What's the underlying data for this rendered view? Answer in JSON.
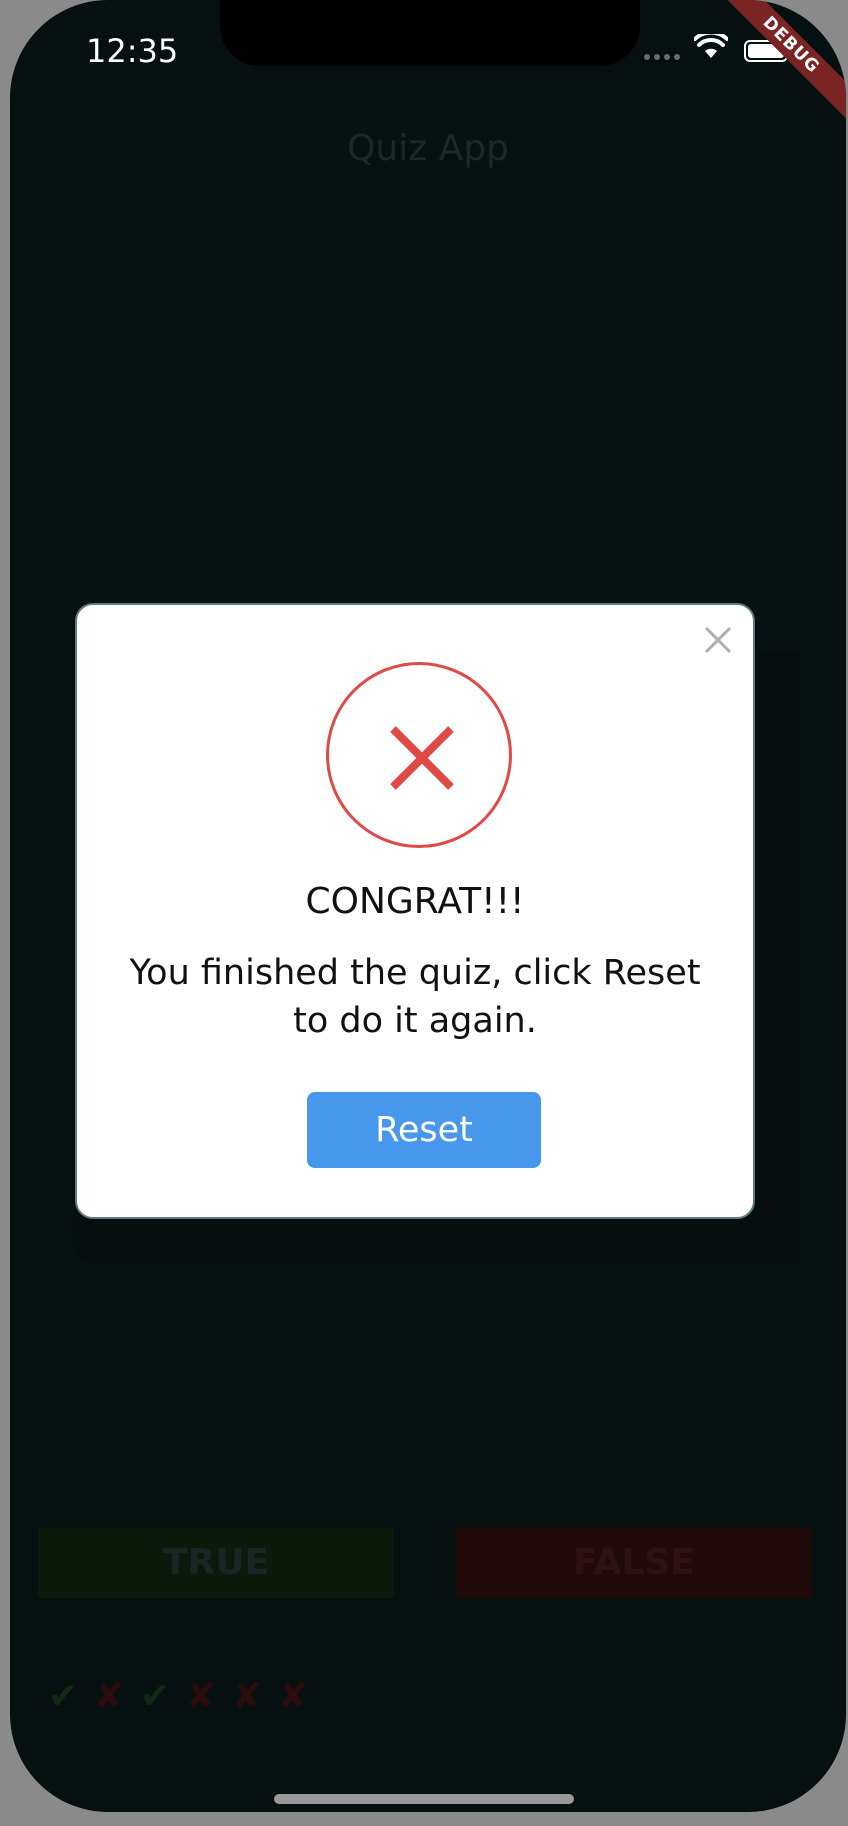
{
  "status_bar": {
    "time": "12:35"
  },
  "debug_banner": {
    "label": "DEBUG"
  },
  "app_bar": {
    "title": "Quiz App"
  },
  "answers": {
    "true_label": "TRUE",
    "false_label": "FALSE"
  },
  "score_keeper": {
    "items": [
      {
        "symbol": "✔",
        "result": "correct",
        "color": "#0e2a10"
      },
      {
        "symbol": "✘",
        "result": "wrong",
        "color": "#2b0b0b"
      },
      {
        "symbol": "✔",
        "result": "correct",
        "color": "#0e2a10"
      },
      {
        "symbol": "✘",
        "result": "wrong",
        "color": "#2b0b0b"
      },
      {
        "symbol": "✘",
        "result": "wrong",
        "color": "#2b0b0b"
      },
      {
        "symbol": "✘",
        "result": "wrong",
        "color": "#2b0b0b"
      }
    ]
  },
  "dialog": {
    "icon": "error-x-icon",
    "title": "CONGRAT!!!",
    "message": "You finished the quiz, click Reset to do it again.",
    "button_label": "Reset",
    "accent_color": "#e04a45",
    "button_color": "#4797ec"
  }
}
